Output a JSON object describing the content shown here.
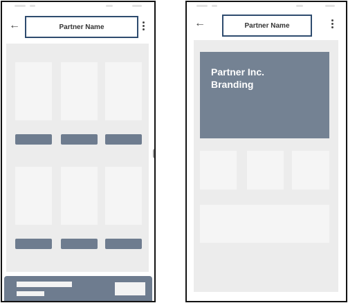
{
  "left_screen": {
    "header": {
      "title": "Partner Name"
    }
  },
  "right_screen": {
    "header": {
      "title": "Partner Name"
    },
    "branding": {
      "line1": "Partner Inc.",
      "line2": "Branding"
    }
  },
  "icons": {
    "back": "arrow-left-icon",
    "more": "more-vertical-icon"
  },
  "colors": {
    "frame": "#111111",
    "title_border": "#2e4b6e",
    "accent_slate": "#6e7c8f",
    "content_bg": "#ececec",
    "card_bg": "#f5f5f5"
  }
}
